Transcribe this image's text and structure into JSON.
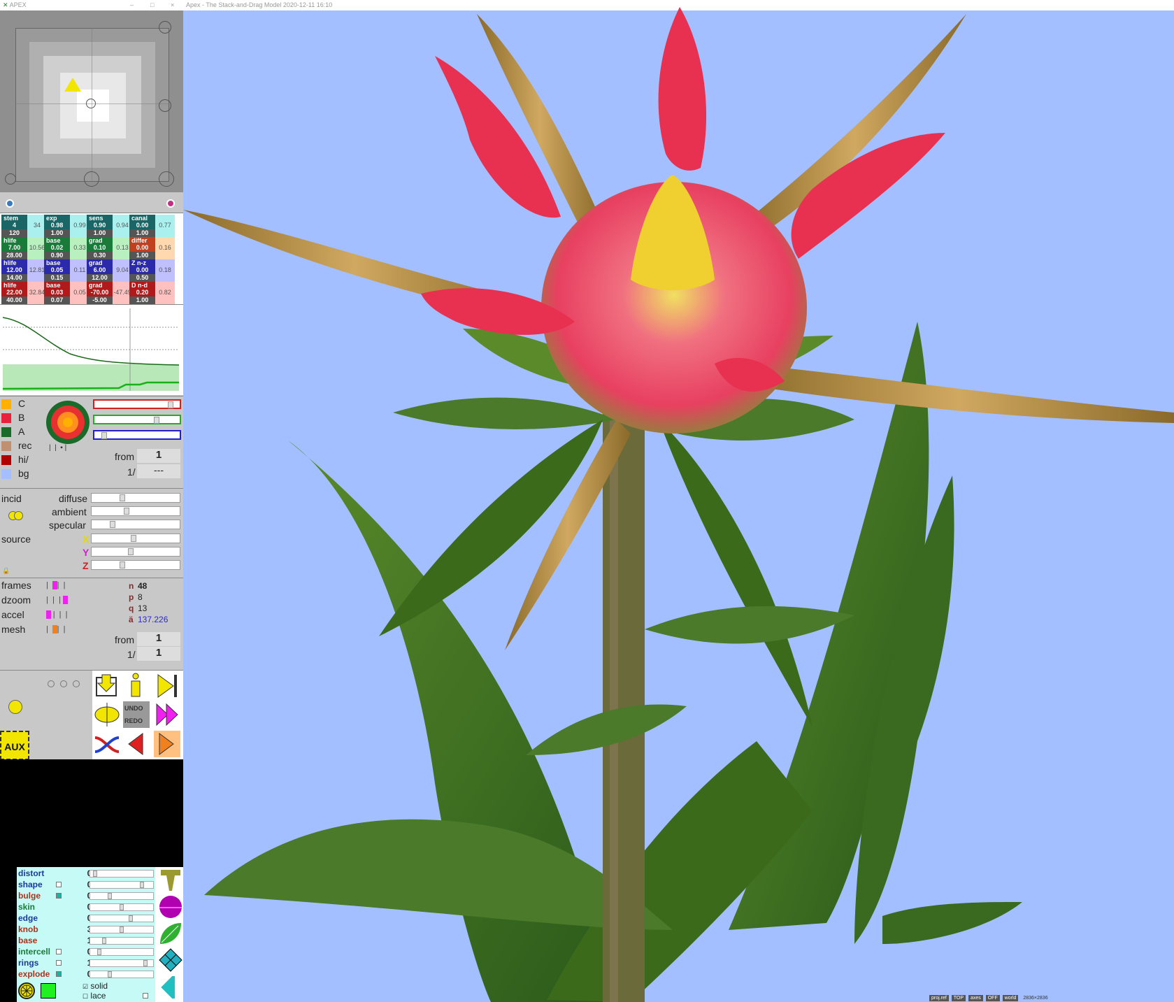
{
  "left_window": {
    "title": "APEX",
    "controls": [
      "–",
      "□",
      "×"
    ]
  },
  "main_window": {
    "title": "Apex - The Stack-and-Drag Model  2020-12-11 16:10"
  },
  "param_grid": {
    "rows": [
      [
        {
          "head": "stem",
          "v1": "4",
          "v2": "120",
          "side": "34",
          "color": "#1a6666",
          "bg": "#a9f0ef"
        },
        {
          "head": "exp",
          "v1": "0.98",
          "v2": "1.00",
          "side": "0.99",
          "color": "#1a6666",
          "bg": "#a9f0ef"
        },
        {
          "head": "sens",
          "v1": "0.90",
          "v2": "1.00",
          "side": "0.94",
          "color": "#1a6666",
          "bg": "#a9f0ef"
        },
        {
          "head": "canal",
          "v1": "0.00",
          "v2": "1.00",
          "side": "0.77",
          "color": "#1a6666",
          "bg": "#a9f0ef"
        }
      ],
      [
        {
          "head": "hlife",
          "v1": "7.00",
          "v2": "28.00",
          "side": "10.56",
          "color": "#1a7a3a",
          "bg": "#b8f0c0"
        },
        {
          "head": "base",
          "v1": "0.02",
          "v2": "0.90",
          "side": "0.33",
          "color": "#1a7a3a",
          "bg": "#b8f0c0"
        },
        {
          "head": "grad",
          "v1": "0.10",
          "v2": "0.30",
          "side": "0.13",
          "color": "#1a7a3a",
          "bg": "#b8f0c0"
        },
        {
          "head": "differ",
          "v1": "0.00",
          "v2": "1.00",
          "side": "0.16",
          "color": "#c04020",
          "bg": "#ffd8b0"
        }
      ],
      [
        {
          "head": "hlife",
          "v1": "12.00",
          "v2": "14.00",
          "side": "12.81",
          "color": "#2a2aaa",
          "bg": "#c0c0ff"
        },
        {
          "head": "base",
          "v1": "0.05",
          "v2": "0.15",
          "side": "0.11",
          "color": "#2a2aaa",
          "bg": "#c0c0ff"
        },
        {
          "head": "grad",
          "v1": "6.00",
          "v2": "12.00",
          "side": "9.04",
          "color": "#2a2aaa",
          "bg": "#c0c0ff"
        },
        {
          "head": "Z n-z",
          "v1": "0.00",
          "v2": "0.50",
          "side": "0.18",
          "color": "#2a2aaa",
          "bg": "#c0c0ff"
        }
      ],
      [
        {
          "head": "hlife",
          "v1": "22.00",
          "v2": "40.00",
          "side": "32.84",
          "color": "#b01a1a",
          "bg": "#ffc0c0"
        },
        {
          "head": "base",
          "v1": "0.03",
          "v2": "0.07",
          "side": "0.05",
          "color": "#b01a1a",
          "bg": "#ffc0c0"
        },
        {
          "head": "grad",
          "v1": "-70.00",
          "v2": "-5.00",
          "side": "-47.49",
          "color": "#b01a1a",
          "bg": "#ffc0c0"
        },
        {
          "head": "D n-d",
          "v1": "0.20",
          "v2": "1.00",
          "side": "0.82",
          "color": "#b01a1a",
          "bg": "#ffc0c0"
        }
      ]
    ]
  },
  "color_panel": {
    "swatches": [
      {
        "label": "C",
        "color": "#ffb000"
      },
      {
        "label": "B",
        "color": "#e8203a"
      },
      {
        "label": "A",
        "color": "#1a6a2a"
      },
      {
        "label": "rec",
        "color": "#c09070"
      },
      {
        "label": "hi/",
        "color": "#b00000"
      },
      {
        "label": "bg",
        "color": "#a3bfff"
      }
    ],
    "from_label": "from",
    "from_value": "1",
    "ratio_label": "1/",
    "ratio_value": "---"
  },
  "light_panel": {
    "incid": "incid",
    "source": "source",
    "diffuse": "diffuse",
    "ambient": "ambient",
    "specular": "specular",
    "x": "X",
    "y": "Y",
    "z": "Z"
  },
  "anim_panel": {
    "rows": [
      "frames",
      "dzoom",
      "accel",
      "mesh"
    ],
    "n_label": "n",
    "n_value": "48",
    "p_label": "p",
    "p_value": "8",
    "q_label": "q",
    "q_value": "13",
    "a_label": "ä",
    "a_value": "137.226",
    "from_label": "from",
    "from_value": "1",
    "ratio_label": "1/",
    "ratio_value": "1"
  },
  "buttons": {
    "undo": "UNDO",
    "redo": "REDO"
  },
  "bottom_params": [
    {
      "name": "distort",
      "value": "0.00",
      "color": "#1a3a9a",
      "check": false,
      "knob": 0.05
    },
    {
      "name": "shape",
      "value": "0.00",
      "color": "#1a3a9a",
      "check": true,
      "knob": 0.85
    },
    {
      "name": "bulge",
      "value": "0.35",
      "color": "#b0301a",
      "check": true,
      "knob": 0.3
    },
    {
      "name": "skin",
      "value": "0.20",
      "color": "#1a7a3a",
      "check": false,
      "knob": 0.5
    },
    {
      "name": "edge",
      "value": "0.50",
      "color": "#1a3a9a",
      "check": false,
      "knob": 0.65
    },
    {
      "name": "knob",
      "value": "3.00",
      "color": "#b0301a",
      "check": false,
      "knob": 0.5
    },
    {
      "name": "base",
      "value": "1.00",
      "color": "#b0301a",
      "check": false,
      "knob": 0.2
    },
    {
      "name": "intercell",
      "value": "0.10",
      "color": "#1a7a3a",
      "check": true,
      "knob": 0.12
    },
    {
      "name": "rings",
      "value": "1.00",
      "color": "#1a3a9a",
      "check": true,
      "knob": 0.9
    },
    {
      "name": "explode",
      "value": "0.35",
      "color": "#b0301a",
      "check": true,
      "knob": 0.3
    }
  ],
  "render_modes": {
    "solid": "solid",
    "lace": "lace"
  },
  "status_bar": {
    "items": [
      "proj.ref",
      "TOP",
      "axes",
      "OFF",
      "world"
    ],
    "size": "2836×2836"
  }
}
